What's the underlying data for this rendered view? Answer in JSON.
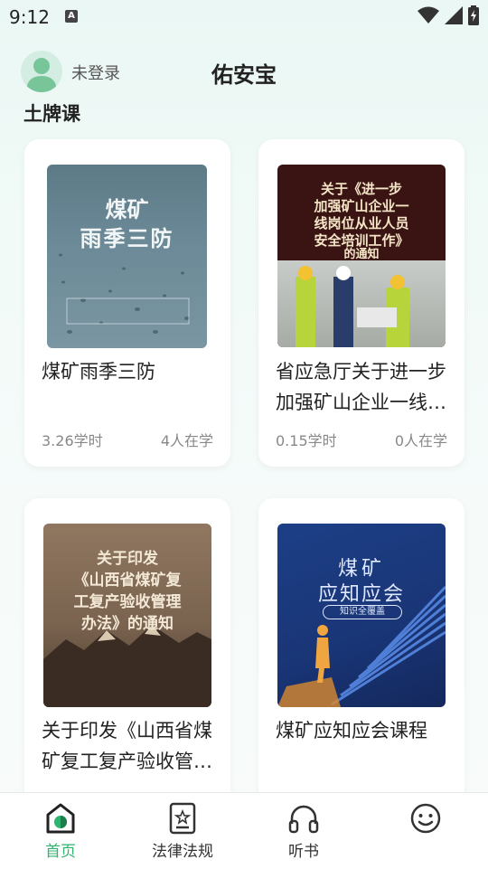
{
  "status_bar": {
    "time": "9:12",
    "indicator": "A"
  },
  "header": {
    "login_status": "未登录",
    "app_title": "佑安宝"
  },
  "section": {
    "title": "土牌课"
  },
  "courses": [
    {
      "title": "煤矿雨季三防",
      "hours": "3.26学时",
      "learners": "4人在学",
      "cover_lines": [
        "煤矿",
        "雨季三防"
      ]
    },
    {
      "title": "省应急厅关于进一步加强矿山企业一线岗位从业人员安全培训工作的通知",
      "hours": "0.15学时",
      "learners": "0人在学",
      "cover_lines": [
        "关于《进一步",
        "加强矿山企业一",
        "线岗位从业人员",
        "安全培训工作》",
        "的通知"
      ]
    },
    {
      "title": "关于印发《山西省煤矿复工复产验收管理办法》的通知",
      "cover_lines": [
        "关于印发",
        "《山西省煤矿复",
        "工复产验收管理",
        "办法》的通知"
      ]
    },
    {
      "title": "煤矿应知应会课程",
      "cover_lines": [
        "煤矿",
        "应知应会",
        "知识全覆盖"
      ]
    }
  ],
  "nav": {
    "home": "首页",
    "law": "法律法规",
    "audio": "听书"
  },
  "colors": {
    "accent": "#2fb36e"
  }
}
